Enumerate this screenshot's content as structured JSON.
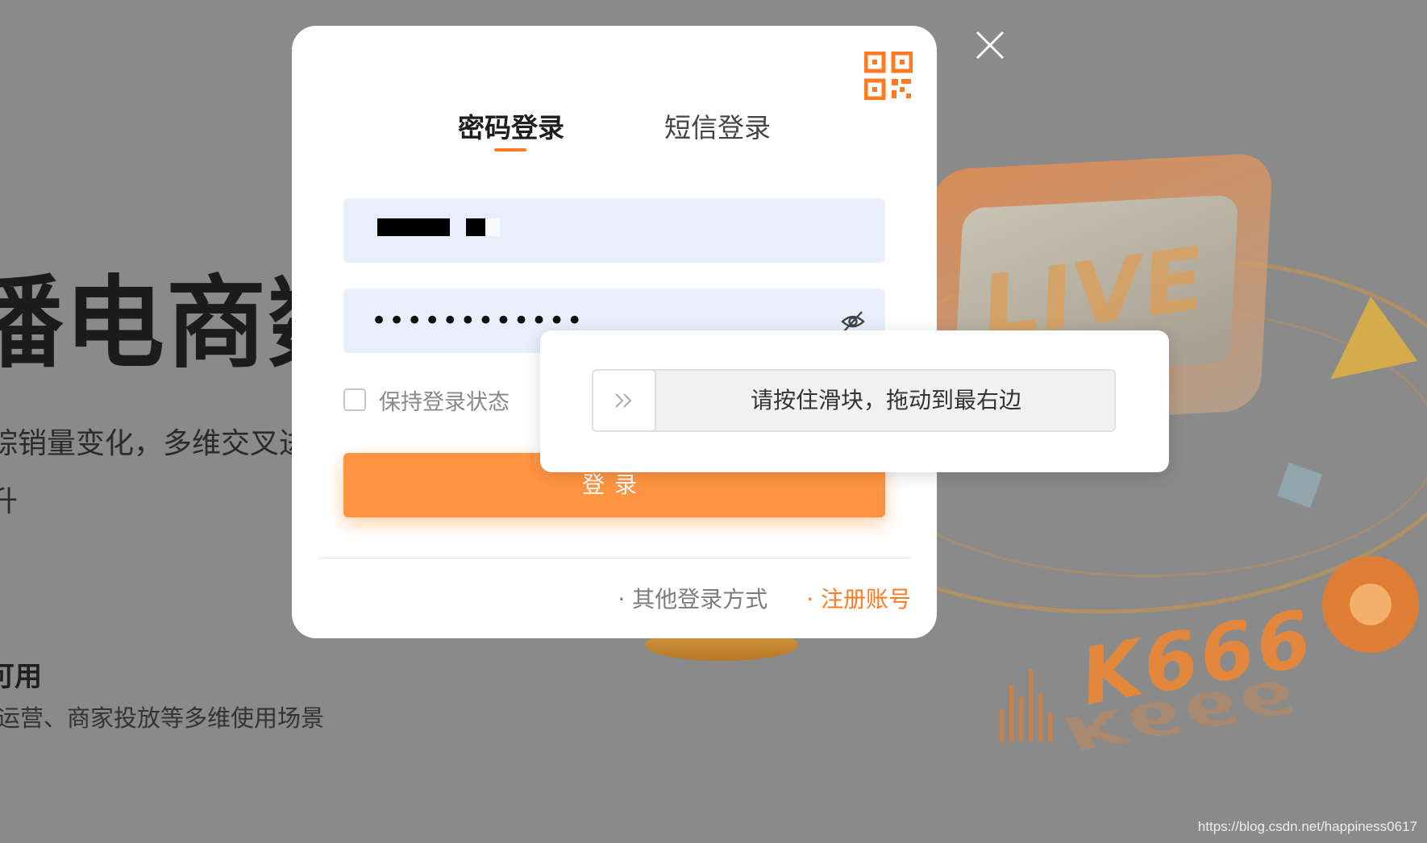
{
  "background": {
    "headline_fragment": "播电商数据",
    "description_lines": [
      "踪销量变化，多维交叉进",
      "升"
    ],
    "feature_title": "可用",
    "feature_desc": "运营、商家投放等多维使用场景",
    "graphic_text_live": "LIVE",
    "graphic_text_k666": "K666"
  },
  "modal": {
    "tabs": [
      {
        "label": "密码登录",
        "active": true
      },
      {
        "label": "短信登录",
        "active": false
      }
    ],
    "password_value": "••••••••••••",
    "remember_label": "保持登录状态",
    "remember_checked": false,
    "login_button": "登录",
    "other_login_link": "· 其他登录方式",
    "register_link": "· 注册账号"
  },
  "captcha": {
    "instruction": "请按住滑块，拖动到最右边"
  },
  "watermark": "https://blog.csdn.net/happiness0617",
  "colors": {
    "accent": "#ff7a21",
    "button": "#ff9442",
    "input_bg": "#e8effb",
    "overlay": "#8a8a8a"
  }
}
